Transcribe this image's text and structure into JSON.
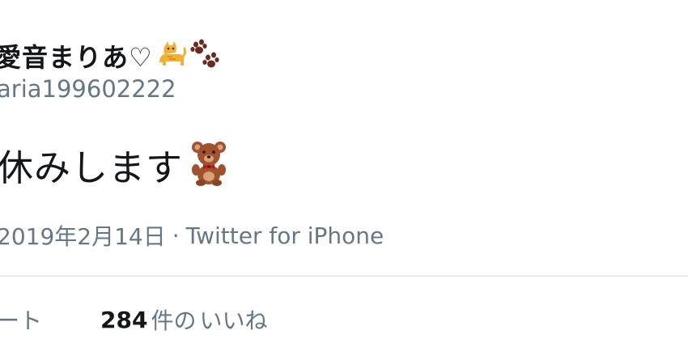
{
  "author": {
    "display_name": "愛音まりあ♡",
    "handle": "aria199602222",
    "name_icons": [
      "cat-emoji-icon",
      "paw-prints-emoji-icon"
    ]
  },
  "tweet": {
    "text": "休みします",
    "text_icon": "teddy-bear-emoji-icon",
    "date": "2019年2月14日",
    "separator": "·",
    "source": "Twitter for iPhone"
  },
  "stats": {
    "retweets_label": "ート",
    "likes_count": "284",
    "likes_label_prefix": "件の",
    "likes_label_link": "いいね"
  },
  "colors": {
    "text_primary": "#14171a",
    "text_secondary": "#657786",
    "divider": "#e6ecf0"
  }
}
